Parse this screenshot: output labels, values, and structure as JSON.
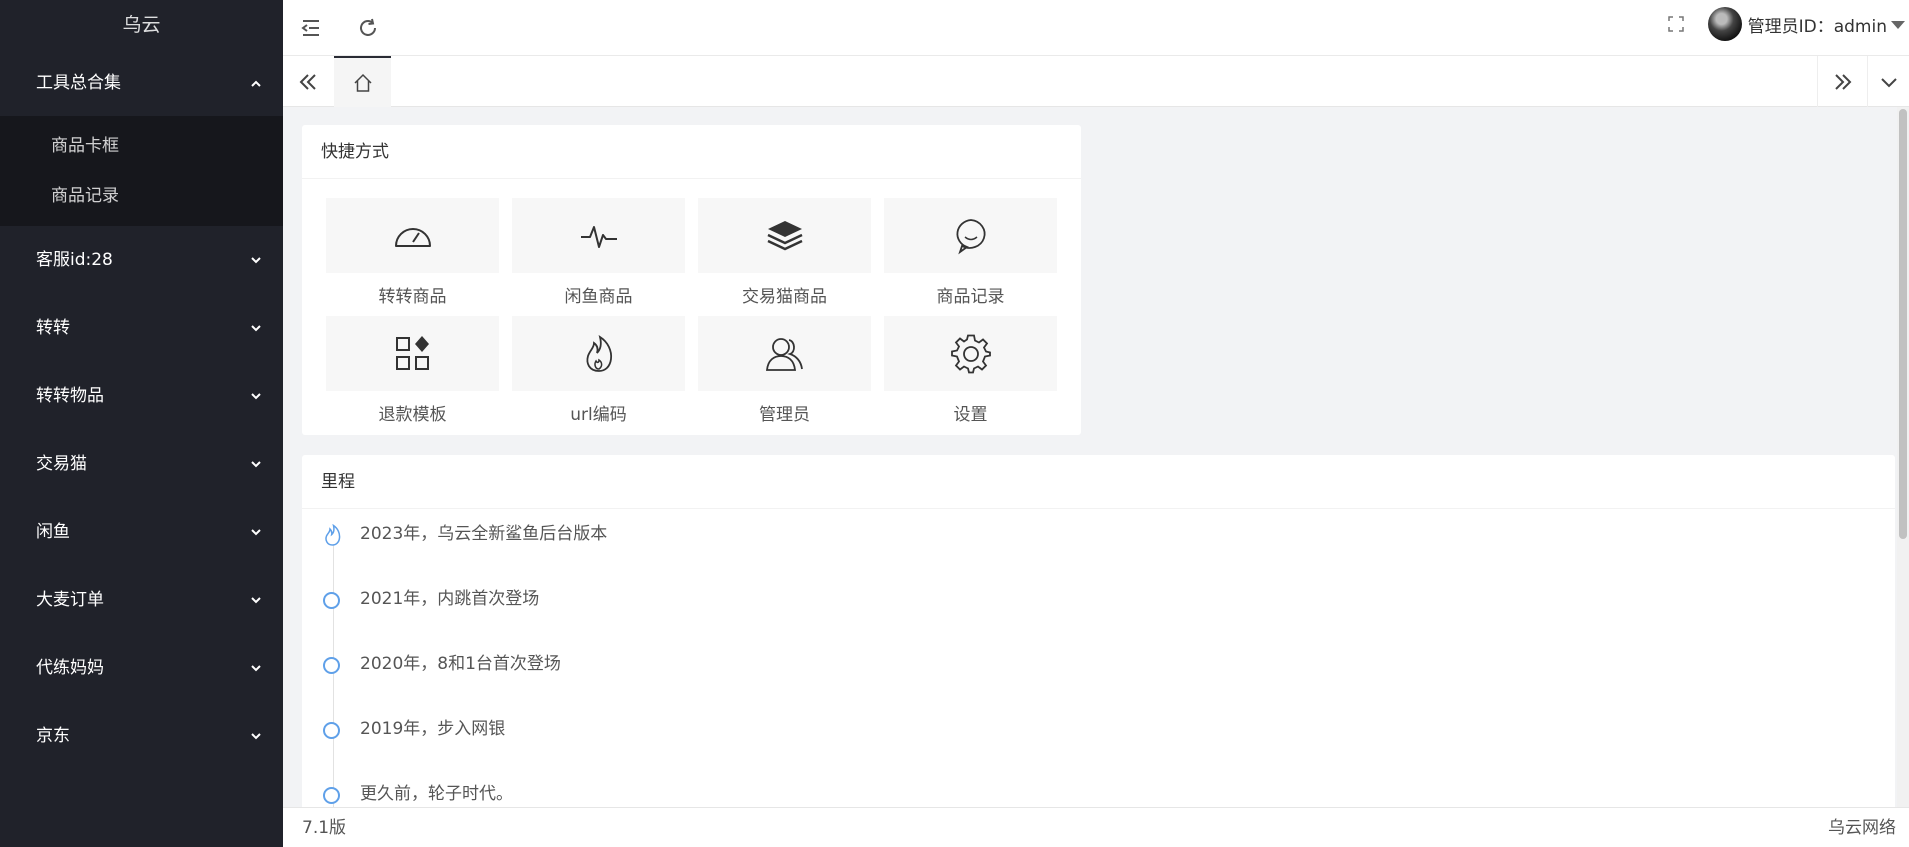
{
  "sidebar": {
    "logo": "乌云",
    "menu": [
      {
        "label": "工具总合集",
        "open": true,
        "children": [
          "商品卡框",
          "商品记录"
        ]
      },
      {
        "label": "客服id:28"
      },
      {
        "label": "转转"
      },
      {
        "label": "转转物品"
      },
      {
        "label": "交易猫"
      },
      {
        "label": "闲鱼"
      },
      {
        "label": "大麦订单"
      },
      {
        "label": "代练妈妈"
      },
      {
        "label": "京东"
      }
    ]
  },
  "header": {
    "user_label": "管理员ID：admin"
  },
  "shortcuts": {
    "title": "快捷方式",
    "items": [
      {
        "label": "转转商品",
        "icon": "dashboard-icon"
      },
      {
        "label": "闲鱼商品",
        "icon": "pulse-icon"
      },
      {
        "label": "交易猫商品",
        "icon": "layers-icon"
      },
      {
        "label": "商品记录",
        "icon": "chat-bubble-icon"
      },
      {
        "label": "退款模板",
        "icon": "apps-icon"
      },
      {
        "label": "url编码",
        "icon": "fire-icon"
      },
      {
        "label": "管理员",
        "icon": "users-icon"
      },
      {
        "label": "设置",
        "icon": "gear-icon"
      }
    ]
  },
  "timeline": {
    "title": "里程",
    "items": [
      "2023年，乌云全新鲨鱼后台版本",
      "2021年，内跳首次登场",
      "2020年，8和1台首次登场",
      "2019年，步入网银",
      "更久前，轮子时代。"
    ]
  },
  "footer": {
    "version": "7.1版",
    "brand": "乌云网络"
  },
  "colors": {
    "sidebar_bg": "#20222a",
    "submenu_bg": "#16171c",
    "timeline_accent": "#5fa0e9"
  }
}
